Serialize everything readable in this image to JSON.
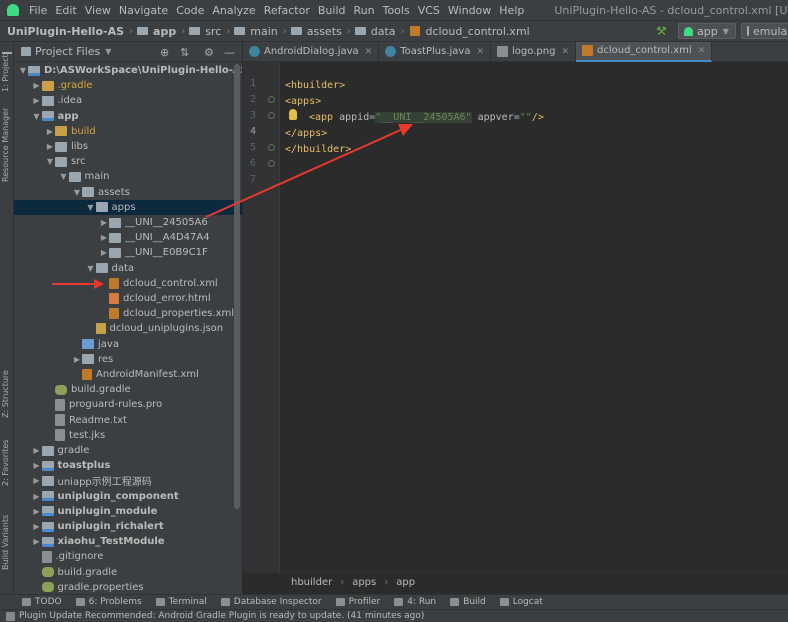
{
  "menu": [
    "File",
    "Edit",
    "View",
    "Navigate",
    "Code",
    "Analyze",
    "Refactor",
    "Build",
    "Run",
    "Tools",
    "VCS",
    "Window",
    "Help"
  ],
  "window_title": "UniPlugin-Hello-AS - dcloud_control.xml [UniPlugin-Hello-AS.app] -",
  "breadcrumb": [
    "UniPlugin-Hello-AS",
    "app",
    "src",
    "main",
    "assets",
    "data",
    "dcloud_control.xml"
  ],
  "run_config": "app",
  "emulator": "emula",
  "left_strip": {
    "project": "1: Project",
    "resource_manager": "Resource Manager",
    "structure": "Z: Structure",
    "favorites": "2: Favorites",
    "build_variants": "Build Variants"
  },
  "project_panel": {
    "title": "Project Files"
  },
  "tree": [
    {
      "label": "D:\\ASWorkSpace\\UniPlugin-Hello-AS",
      "depth": 0,
      "arrow": "down",
      "icon": "mod",
      "bold": true
    },
    {
      "label": ".gradle",
      "depth": 1,
      "arrow": "right",
      "icon": "ex",
      "orange": true
    },
    {
      "label": ".idea",
      "depth": 1,
      "arrow": "right",
      "icon": "f"
    },
    {
      "label": "app",
      "depth": 1,
      "arrow": "down",
      "icon": "mod",
      "bold": true
    },
    {
      "label": "build",
      "depth": 2,
      "arrow": "right",
      "icon": "ex",
      "orange": true
    },
    {
      "label": "libs",
      "depth": 2,
      "arrow": "right",
      "icon": "f"
    },
    {
      "label": "src",
      "depth": 2,
      "arrow": "down",
      "icon": "f"
    },
    {
      "label": "main",
      "depth": 3,
      "arrow": "down",
      "icon": "f"
    },
    {
      "label": "assets",
      "depth": 4,
      "arrow": "down",
      "icon": "f"
    },
    {
      "label": "apps",
      "depth": 5,
      "arrow": "down",
      "icon": "f",
      "selected": true
    },
    {
      "label": "__UNI__24505A6",
      "depth": 6,
      "arrow": "right",
      "icon": "f"
    },
    {
      "label": "__UNI__A4D47A4",
      "depth": 6,
      "arrow": "right",
      "icon": "f"
    },
    {
      "label": "__UNI__E0B9C1F",
      "depth": 6,
      "arrow": "right",
      "icon": "f"
    },
    {
      "label": "data",
      "depth": 5,
      "arrow": "down",
      "icon": "f"
    },
    {
      "label": "dcloud_control.xml",
      "depth": 6,
      "arrow": "",
      "icon": "xm"
    },
    {
      "label": "dcloud_error.html",
      "depth": 6,
      "arrow": "",
      "icon": "htm"
    },
    {
      "label": "dcloud_properties.xml",
      "depth": 6,
      "arrow": "",
      "icon": "xm"
    },
    {
      "label": "dcloud_uniplugins.json",
      "depth": 5,
      "arrow": "",
      "icon": "js"
    },
    {
      "label": "java",
      "depth": 4,
      "arrow": "",
      "icon": "bl"
    },
    {
      "label": "res",
      "depth": 4,
      "arrow": "right",
      "icon": "f"
    },
    {
      "label": "AndroidManifest.xml",
      "depth": 4,
      "arrow": "",
      "icon": "xm"
    },
    {
      "label": "build.gradle",
      "depth": 2,
      "arrow": "",
      "icon": "gr"
    },
    {
      "label": "proguard-rules.pro",
      "depth": 2,
      "arrow": "",
      "icon": "fl"
    },
    {
      "label": "Readme.txt",
      "depth": 2,
      "arrow": "",
      "icon": "fl"
    },
    {
      "label": "test.jks",
      "depth": 2,
      "arrow": "",
      "icon": "fl"
    },
    {
      "label": "gradle",
      "depth": 1,
      "arrow": "right",
      "icon": "f"
    },
    {
      "label": "toastplus",
      "depth": 1,
      "arrow": "right",
      "icon": "mod",
      "bold": true
    },
    {
      "label": "uniapp示例工程源码",
      "depth": 1,
      "arrow": "right",
      "icon": "f"
    },
    {
      "label": "uniplugin_component",
      "depth": 1,
      "arrow": "right",
      "icon": "mod",
      "bold": true
    },
    {
      "label": "uniplugin_module",
      "depth": 1,
      "arrow": "right",
      "icon": "mod",
      "bold": true
    },
    {
      "label": "uniplugin_richalert",
      "depth": 1,
      "arrow": "right",
      "icon": "mod",
      "bold": true
    },
    {
      "label": "xiaohu_TestModule",
      "depth": 1,
      "arrow": "right",
      "icon": "mod",
      "bold": true
    },
    {
      "label": ".gitignore",
      "depth": 1,
      "arrow": "",
      "icon": "fl"
    },
    {
      "label": "build.gradle",
      "depth": 1,
      "arrow": "",
      "icon": "gr"
    },
    {
      "label": "gradle.properties",
      "depth": 1,
      "arrow": "",
      "icon": "gr"
    }
  ],
  "tabs": [
    {
      "label": "AndroidDialog.java",
      "icon": "java"
    },
    {
      "label": "ToastPlus.java",
      "icon": "java"
    },
    {
      "label": "logo.png",
      "icon": "png"
    },
    {
      "label": "dcloud_control.xml",
      "icon": "xml",
      "active": true
    }
  ],
  "line_numbers": [
    "1",
    "2",
    "3",
    "4",
    "5",
    "6",
    "7"
  ],
  "code": {
    "l2_tag": "<hbuilder>",
    "l3_tag": "<apps>",
    "l4_open": "<app ",
    "l4_attr1": "appid",
    "l4_eq1": "=",
    "l4_val1": "\"__UNI__24505A6\"",
    "l4_attr2": " appver",
    "l4_eq2": "=",
    "l4_val2": "\"\"",
    "l4_close": "/>",
    "l5_tag": "</apps>",
    "l6_tag": "</hbuilder>"
  },
  "editor_breadcrumb": [
    "hbuilder",
    "apps",
    "app"
  ],
  "tool_windows": [
    "TODO",
    "6: Problems",
    "Terminal",
    "Database Inspector",
    "Profiler",
    "4: Run",
    "Build",
    "Logcat"
  ],
  "status": "Plugin Update Recommended: Android Gradle Plugin is ready to update. (41 minutes ago)"
}
